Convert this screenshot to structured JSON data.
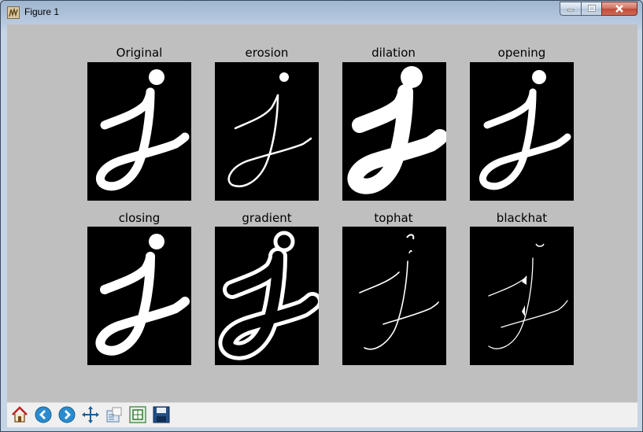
{
  "window": {
    "title": "Figure 1"
  },
  "panels": [
    {
      "title": "Original"
    },
    {
      "title": "erosion"
    },
    {
      "title": "dilation"
    },
    {
      "title": "opening"
    },
    {
      "title": "closing"
    },
    {
      "title": "gradient"
    },
    {
      "title": "tophat"
    },
    {
      "title": "blackhat"
    }
  ],
  "toolbar": {
    "icons": [
      "home-icon",
      "back-icon",
      "forward-icon",
      "pan-icon",
      "zoom-icon",
      "configure-subplots-icon",
      "save-icon"
    ]
  }
}
